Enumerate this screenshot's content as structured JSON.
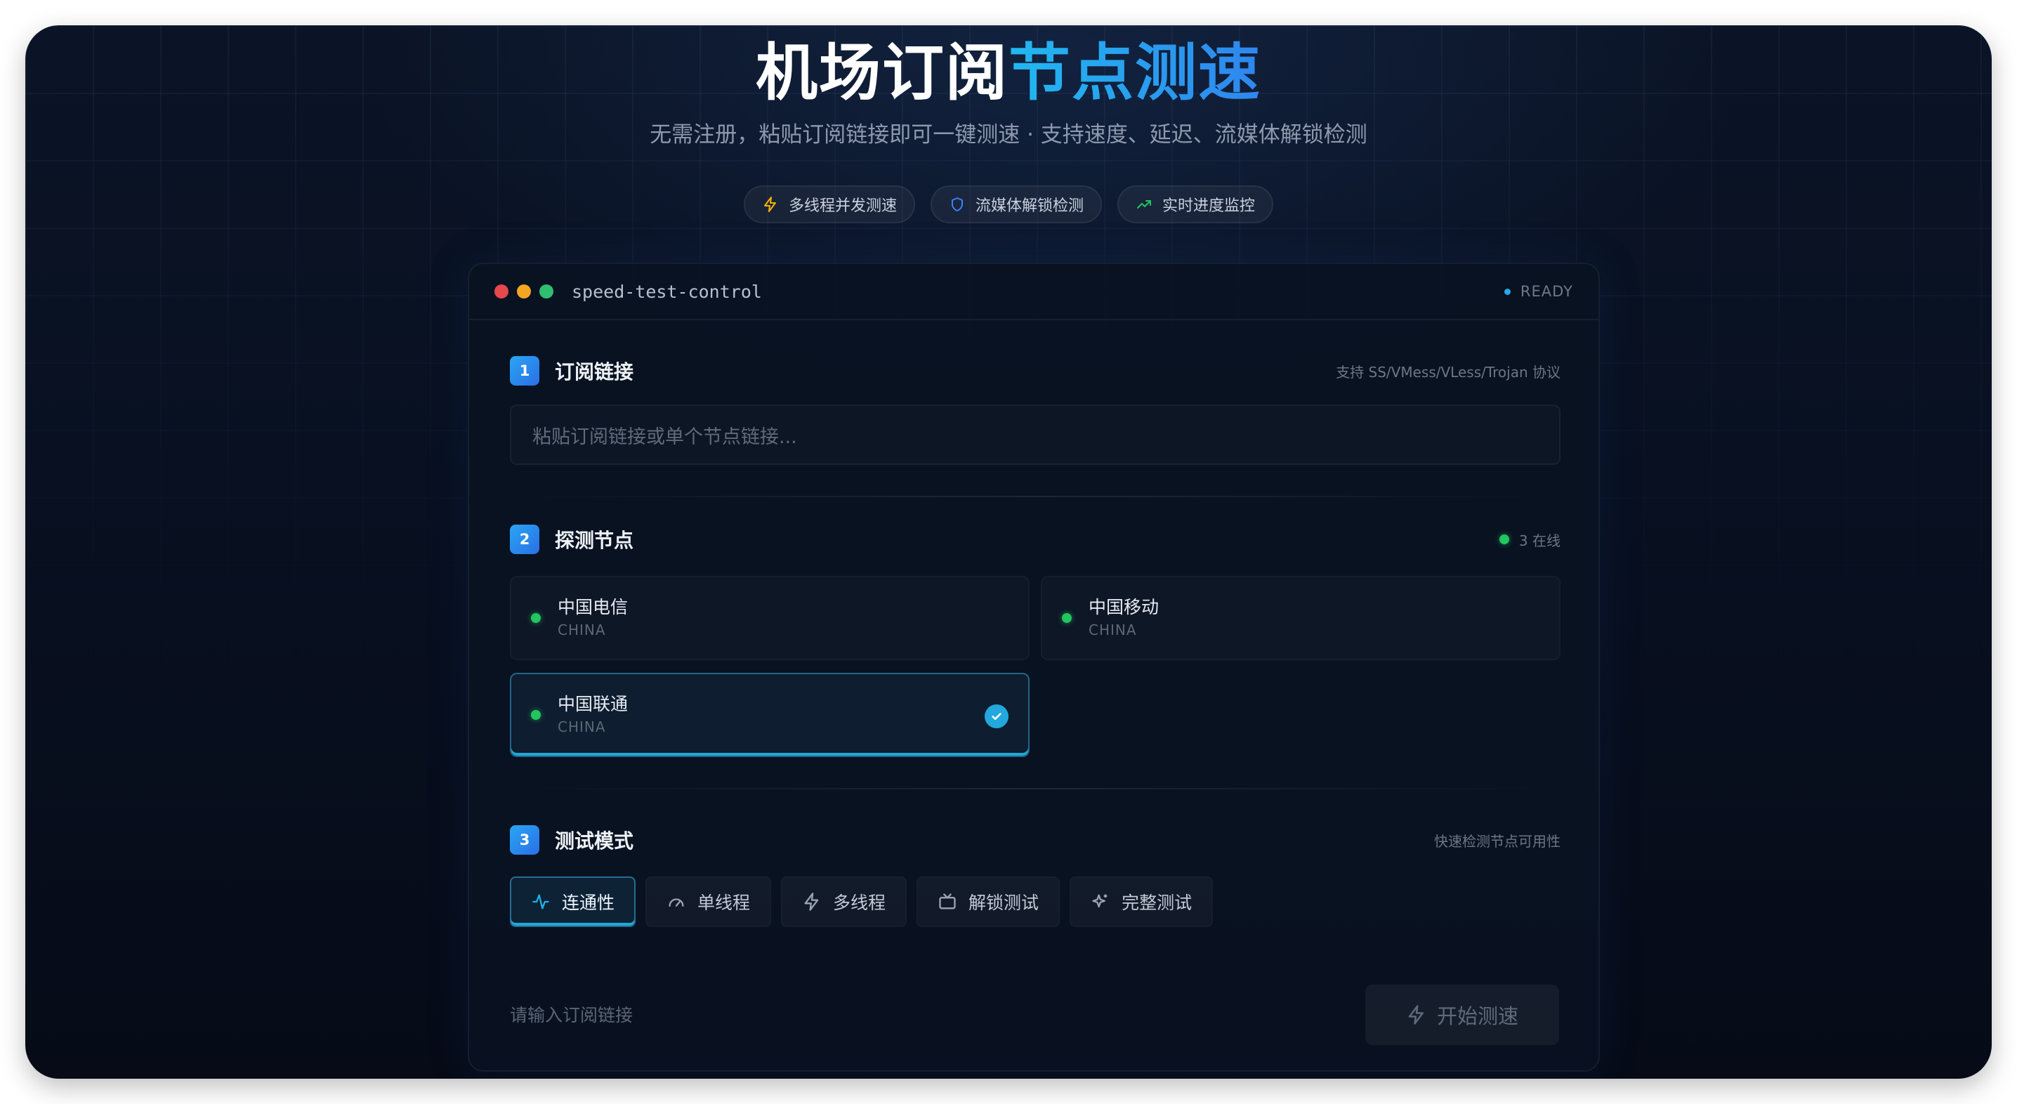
{
  "hero": {
    "title_main": "机场订阅",
    "title_accent": "节点测速",
    "subtitle": "无需注册，粘贴订阅链接即可一键测速 · 支持速度、延迟、流媒体解锁检测",
    "chips": [
      {
        "label": "多线程并发测速",
        "icon": "lightning-icon",
        "color": "#f4b400"
      },
      {
        "label": "流媒体解锁检测",
        "icon": "shield-icon",
        "color": "#3b82f6"
      },
      {
        "label": "实时进度监控",
        "icon": "trending-up-icon",
        "color": "#22c55e"
      }
    ]
  },
  "panel": {
    "title": "speed-test-control",
    "status": "READY",
    "window_dots": [
      "#e5484d",
      "#f5a524",
      "#2fbf71"
    ]
  },
  "step1": {
    "num": "1",
    "title": "订阅链接",
    "note": "支持 SS/VMess/VLess/Trojan 协议",
    "placeholder": "粘贴订阅链接或单个节点链接..."
  },
  "step2": {
    "num": "2",
    "title": "探测节点",
    "online": "3 在线",
    "nodes": [
      {
        "name": "中国电信",
        "region": "CHINA",
        "selected": false
      },
      {
        "name": "中国移动",
        "region": "CHINA",
        "selected": false
      },
      {
        "name": "中国联通",
        "region": "CHINA",
        "selected": true
      }
    ]
  },
  "step3": {
    "num": "3",
    "title": "测试模式",
    "note": "快速检测节点可用性",
    "modes": [
      {
        "label": "连通性",
        "icon": "activity-icon",
        "active": true
      },
      {
        "label": "单线程",
        "icon": "gauge-icon",
        "active": false
      },
      {
        "label": "多线程",
        "icon": "lightning-icon",
        "active": false
      },
      {
        "label": "解锁测试",
        "icon": "tv-icon",
        "active": false
      },
      {
        "label": "完整测试",
        "icon": "sparkles-icon",
        "active": false
      }
    ]
  },
  "footer": {
    "hint": "请输入订阅链接",
    "start_label": "开始测速"
  }
}
